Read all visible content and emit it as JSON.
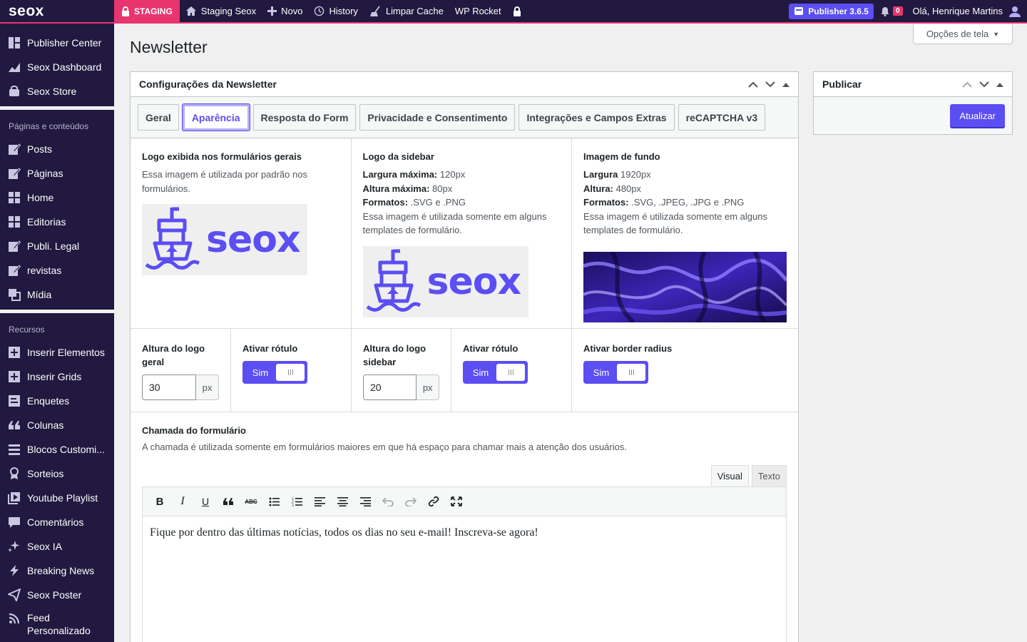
{
  "adminbar": {
    "logo": "seox",
    "staging": "STAGING",
    "items": [
      "Staging Seox",
      "Novo",
      "History",
      "Limpar Cache",
      "WP Rocket"
    ],
    "publisher_badge": "Publisher 3.6.5",
    "notifications": "0",
    "greeting": "Olá, Henrique Martins"
  },
  "sidebar": {
    "top": [
      "Publisher Center",
      "Seox Dashboard",
      "Seox Store"
    ],
    "section1": "Páginas e conteúdos",
    "content": [
      "Posts",
      "Páginas",
      "Home",
      "Editorias",
      "Publi. Legal",
      "revistas",
      "Mídia"
    ],
    "section2": "Recursos",
    "resources": [
      "Inserir Elementos",
      "Inserir Grids",
      "Enquetes",
      "Colunas",
      "Blocos Customi...",
      "Sorteios",
      "Youtube Playlist",
      "Comentários",
      "Seox IA",
      "Breaking News",
      "Seox Poster",
      "Feed Personalizado"
    ]
  },
  "page": {
    "title": "Newsletter",
    "screen_options": "Opções de tela"
  },
  "settings": {
    "title": "Configurações da Newsletter",
    "tabs": [
      "Geral",
      "Aparência",
      "Resposta do Form",
      "Privacidade e Consentimento",
      "Integrações e Campos Extras",
      "reCAPTCHA v3"
    ],
    "active_tab": "Aparência",
    "logo_general": {
      "title": "Logo exibida nos formulários gerais",
      "desc": "Essa imagem é utilizada por padrão nos formulários.",
      "logo_text": "seox"
    },
    "logo_sidebar": {
      "title": "Logo da sidebar",
      "l1": "Largura máxima:",
      "v1": " 120px",
      "l2": "Altura máxima:",
      "v2": " 80px",
      "l3": "Formatos:",
      "v3": " .SVG e .PNG",
      "desc": "Essa imagem é utilizada somente em alguns templates de formulário.",
      "logo_text": "seox"
    },
    "bg_image": {
      "title": "Imagem de fundo",
      "l1": "Largura",
      "v1": " 1920px",
      "l2": "Altura:",
      "v2": " 480px",
      "l3": "Formatos:",
      "v3": " .SVG, .JPEG, .JPG e .PNG",
      "desc": "Essa imagem é utilizada somente em alguns templates de formulário."
    },
    "logo_height_general": {
      "label": "Altura do logo geral",
      "value": "30",
      "unit": "px"
    },
    "label_toggle_1": {
      "label": "Ativar rótulo",
      "value": "Sim"
    },
    "logo_height_sidebar": {
      "label": "Altura do logo sidebar",
      "value": "20",
      "unit": "px"
    },
    "label_toggle_2": {
      "label": "Ativar rótulo",
      "value": "Sim"
    },
    "border_radius_toggle": {
      "label": "Ativar border radius",
      "value": "Sim"
    },
    "call": {
      "title": "Chamada do formulário",
      "desc": "A chamada é utilizada somente em formulários maiores em que há espaço para chamar mais a atenção dos usuários.",
      "tab_visual": "Visual",
      "tab_text": "Texto",
      "content": "Fique por dentro das últimas notícias, todos os dias no seu e-mail! Inscreva-se agora!"
    }
  },
  "publish": {
    "title": "Publicar",
    "button": "Atualizar"
  },
  "colors": {
    "accent": "#5b4ef2",
    "admin_bg": "#21193f",
    "staging": "#e8356f"
  }
}
